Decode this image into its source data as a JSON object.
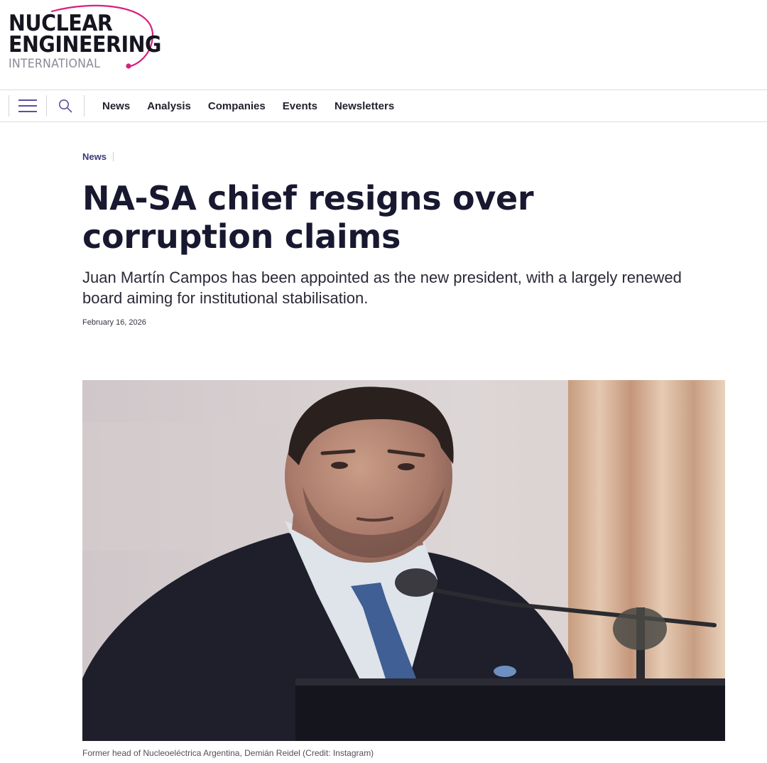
{
  "logo": {
    "line1": "NUCLEAR",
    "line2": "ENGINEERING",
    "line3": "INTERNATIONAL",
    "accent_color": "#d6207f"
  },
  "nav": {
    "menu_icon": "hamburger-icon",
    "search_icon": "search-icon",
    "links": [
      "News",
      "Analysis",
      "Companies",
      "Events",
      "Newsletters"
    ]
  },
  "article": {
    "category": "News",
    "headline": "NA-SA chief resigns over corruption claims",
    "standfirst": "Juan Martín Campos has been appointed as the new president, with a largely renewed board aiming for institutional stabilisation.",
    "date": "February 16, 2026",
    "image_caption": "Former head of Nucleoeléctrica Argentina, Demián Reidel (Credit: Instagram)"
  },
  "colors": {
    "headline": "#181830",
    "category": "#3a3a7a",
    "nav_icons": "#5a4fa0"
  }
}
